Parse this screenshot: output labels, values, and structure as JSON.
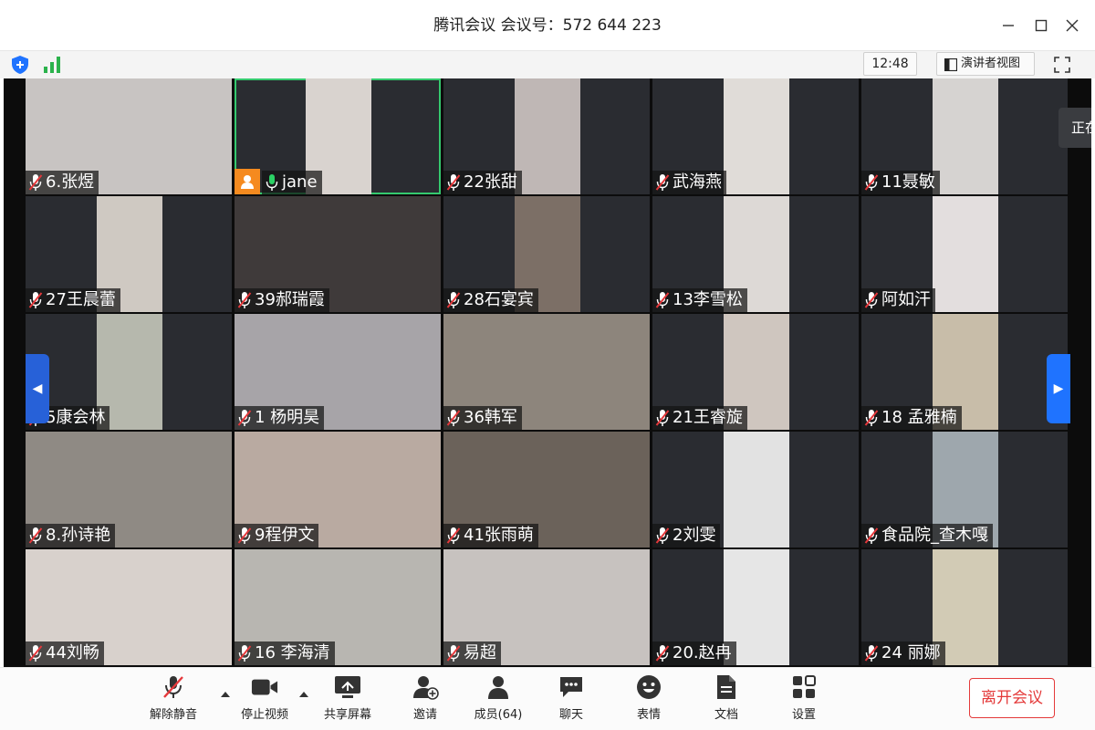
{
  "window": {
    "title": "腾讯会议 会议号：572 644 223",
    "controls": [
      "minimize-icon",
      "maximize-icon",
      "close-icon"
    ]
  },
  "infobar": {
    "time": "12:48",
    "speaker_view_label": "演讲者视图",
    "security_icon": "shield-icon",
    "network_icon": "signal-icon",
    "fullscreen_icon": "fullscreen-icon"
  },
  "speaking_indicator": "正在",
  "participants": [
    {
      "name": "6.张煜",
      "muted": true
    },
    {
      "name": "jane",
      "muted": false,
      "host": true,
      "active_speaker": true
    },
    {
      "name": "22张甜",
      "muted": true
    },
    {
      "name": "武海燕",
      "muted": true
    },
    {
      "name": "11聂敏",
      "muted": true
    },
    {
      "name": "27王晨蕾",
      "muted": true
    },
    {
      "name": "39郝瑞霞",
      "muted": true
    },
    {
      "name": "28石宴宾",
      "muted": true
    },
    {
      "name": "13李雪松",
      "muted": true
    },
    {
      "name": "阿如汗",
      "muted": true
    },
    {
      "name": "5康会林",
      "muted": true
    },
    {
      "name": "1 杨明昊",
      "muted": true
    },
    {
      "name": "36韩军",
      "muted": true
    },
    {
      "name": "21王睿旋",
      "muted": true
    },
    {
      "name": "18 孟雅楠",
      "muted": true
    },
    {
      "name": "8.孙诗艳",
      "muted": true
    },
    {
      "name": "9程伊文",
      "muted": true
    },
    {
      "name": "41张雨萌",
      "muted": true
    },
    {
      "name": "2刘雯",
      "muted": true
    },
    {
      "name": "食品院_查木嘎",
      "muted": true
    },
    {
      "name": "44刘畅",
      "muted": true
    },
    {
      "name": "16 李海清",
      "muted": true
    },
    {
      "name": "易超",
      "muted": true
    },
    {
      "name": "20.赵冉",
      "muted": true
    },
    {
      "name": "24 丽娜",
      "muted": true
    }
  ],
  "toolbar": {
    "unmute": "解除静音",
    "stop_video": "停止视频",
    "share_screen": "共享屏幕",
    "invite": "邀请",
    "members": "成员(64)",
    "chat": "聊天",
    "reactions": "表情",
    "docs": "文档",
    "settings": "设置",
    "leave": "离开会议"
  },
  "colors": {
    "accent_blue": "#1f73ff",
    "active_outline": "#35c96e",
    "host_badge": "#f58a1f",
    "leave_red": "#e43a3a",
    "mute_red": "#e5383b"
  }
}
